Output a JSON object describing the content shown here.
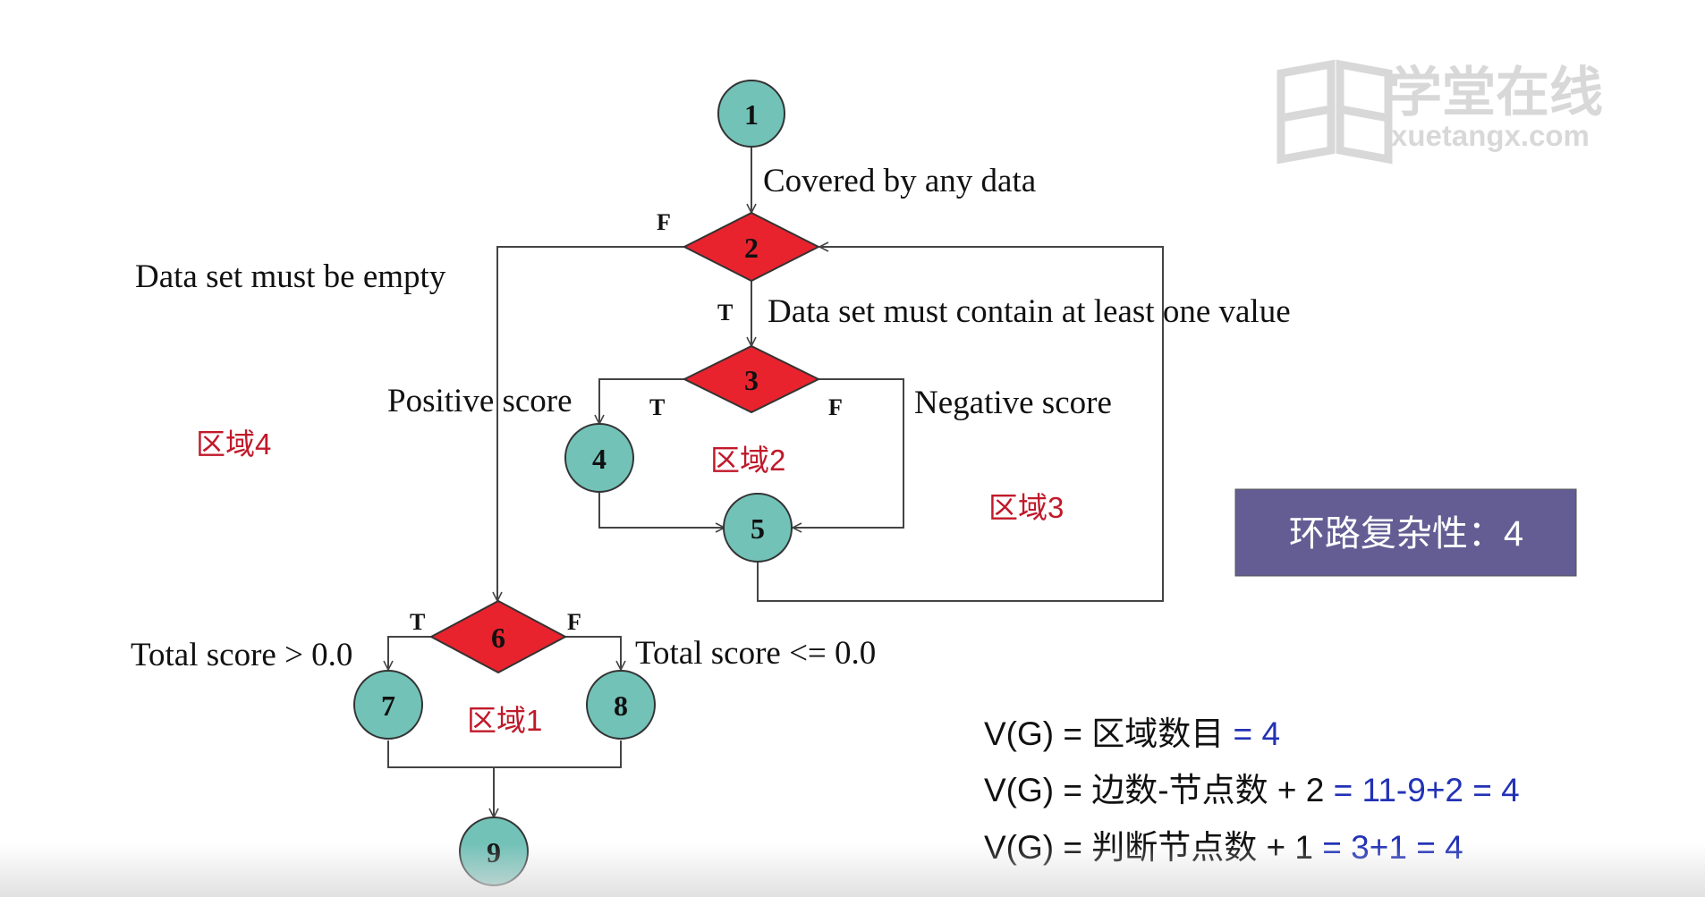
{
  "watermark": {
    "brand_cn": "学堂在线",
    "brand_url": "xuetangx.com"
  },
  "nodes": {
    "n1": "1",
    "n2": "2",
    "n3": "3",
    "n4": "4",
    "n5": "5",
    "n6": "6",
    "n7": "7",
    "n8": "8",
    "n9": "9"
  },
  "edge_labels": {
    "f2": "F",
    "t2": "T",
    "t3": "T",
    "f3": "F",
    "t6": "T",
    "f6": "F"
  },
  "annotations": {
    "covered": "Covered by any data",
    "empty": "Data set must be empty",
    "contain": "Data set must contain at least one value",
    "positive": "Positive score",
    "negative": "Negative score",
    "total_gt": "Total score > 0.0",
    "total_le": "Total score <= 0.0"
  },
  "regions": {
    "r1": "区域1",
    "r2": "区域2",
    "r3": "区域3",
    "r4": "区域4"
  },
  "complexity_box": {
    "label": "环路复杂性：4"
  },
  "formulas": [
    {
      "lhs": "V(G)  =  区域数目",
      "rhs": " = 4"
    },
    {
      "lhs": "V(G)  =  边数-节点数 + 2",
      "rhs": "  = 11-9+2 = 4"
    },
    {
      "lhs": "V(G)  =  判断节点数 + 1",
      "rhs": " = 3+1 = 4"
    }
  ],
  "colors": {
    "node_fill": "#72c2b8",
    "decision_fill": "#e8232e",
    "region_text": "#c0192a",
    "complexity_bg": "#645d94",
    "formula_blue": "#2232b6",
    "line": "#444444"
  }
}
